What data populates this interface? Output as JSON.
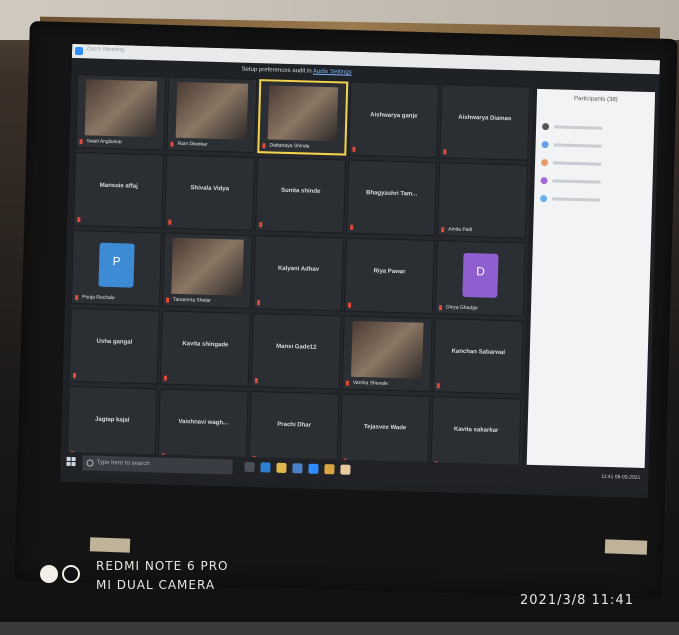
{
  "meeting": {
    "window_title": "Zoom Meeting",
    "banner_prefix": "Setup preferences audit in",
    "banner_link": "Audio Settings",
    "participants_title": "Participants (38)"
  },
  "tiles": [
    {
      "name": "",
      "caption": "Swati Anglavkar",
      "video": true
    },
    {
      "name": "",
      "caption": "Ram Diwekar",
      "video": true
    },
    {
      "name": "",
      "caption": "Dattatraya Shinde",
      "video": true,
      "active": true
    },
    {
      "name": "Aishwarya ganje",
      "caption": ""
    },
    {
      "name": "Aishwarya Diamas",
      "caption": ""
    },
    {
      "name": "Mansoie affaj",
      "caption": ""
    },
    {
      "name": "Shivala Vidya",
      "caption": ""
    },
    {
      "name": "Sunita shinde",
      "caption": ""
    },
    {
      "name": "Bhagyashri Tam...",
      "caption": ""
    },
    {
      "name": "",
      "caption": "Amita Patil"
    },
    {
      "name": "",
      "caption": "Pooja Rochale",
      "avatar": "P"
    },
    {
      "name": "",
      "caption": "Tanamma Shelar",
      "video": true
    },
    {
      "name": "Kalyani Adhav",
      "caption": ""
    },
    {
      "name": "Riya Pawar",
      "caption": ""
    },
    {
      "name": "",
      "caption": "Divya Ghadge",
      "avatar": "D"
    },
    {
      "name": "Usha gangal",
      "caption": ""
    },
    {
      "name": "Kavita shingade",
      "caption": ""
    },
    {
      "name": "Mansi Gade12",
      "caption": ""
    },
    {
      "name": "",
      "caption": "Varsha Shevale",
      "video": true
    },
    {
      "name": "Kanchan Sabarwal",
      "caption": ""
    },
    {
      "name": "Jagtap kajal",
      "caption": ""
    },
    {
      "name": "Vaishnavi wagh...",
      "caption": ""
    },
    {
      "name": "Prachi Dhar",
      "caption": ""
    },
    {
      "name": "Tejasvee Wade",
      "caption": ""
    },
    {
      "name": "Kavita sakarkar",
      "caption": ""
    }
  ],
  "taskbar": {
    "search_placeholder": "Type here to search",
    "time": "11:41",
    "date": "08-03-2021"
  },
  "watermark": {
    "line1": "REDMI NOTE 6 PRO",
    "line2": "MI DUAL CAMERA",
    "timestamp": "2021/3/8  11:41"
  }
}
